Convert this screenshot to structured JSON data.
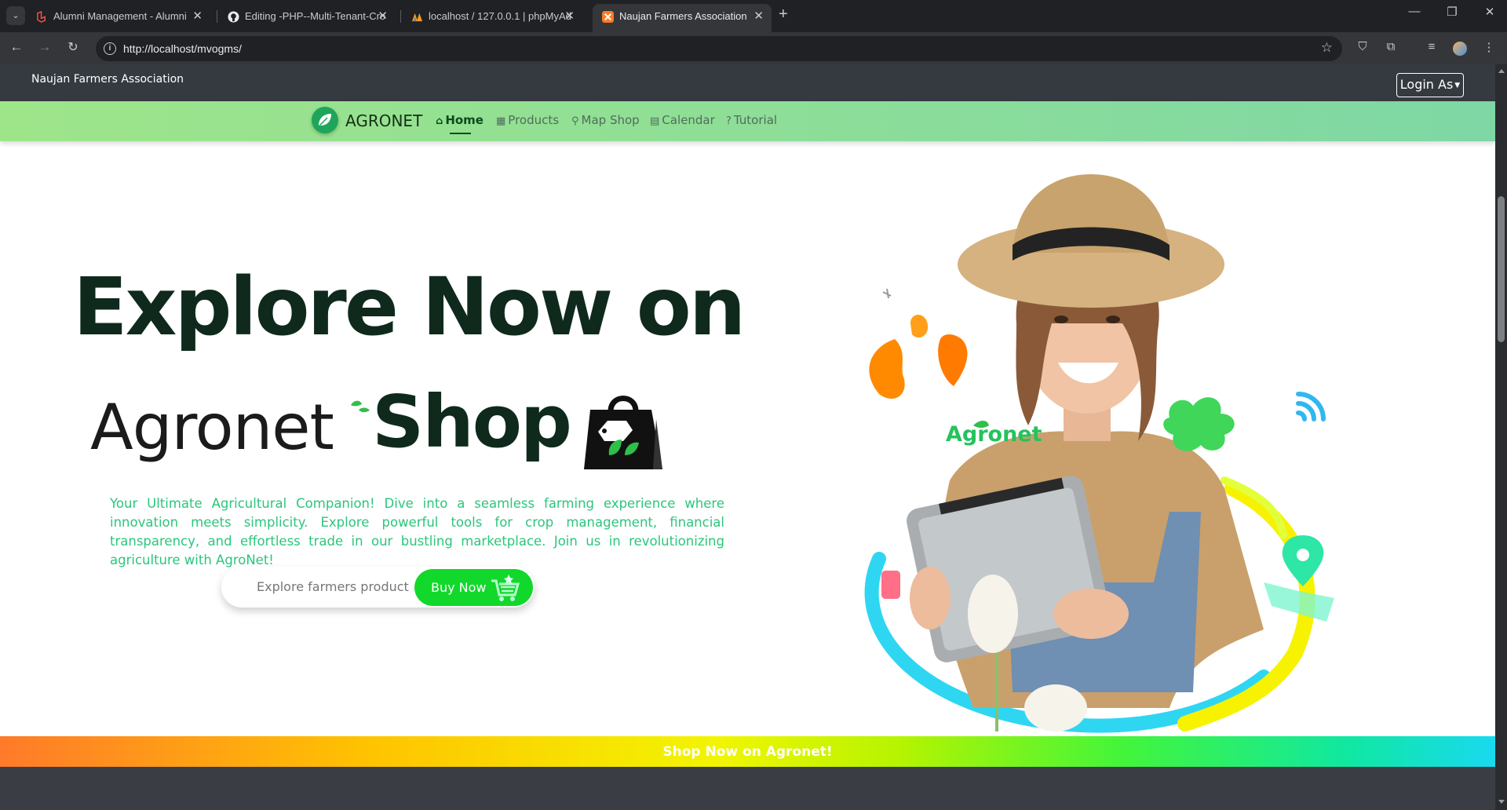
{
  "browser": {
    "tabs": [
      {
        "title": "Alumni Management - Alumni",
        "active": false
      },
      {
        "title": "Editing -PHP--Multi-Tenant-Cro",
        "active": false
      },
      {
        "title": "localhost / 127.0.0.1 | phpMyAd",
        "active": false
      },
      {
        "title": "Naujan Farmers Association",
        "active": true
      }
    ],
    "url": "http://localhost/mvogms/"
  },
  "topbar": {
    "site_name": "Naujan Farmers Association",
    "login_label": "Login As"
  },
  "navbar": {
    "brand": "AGRONET",
    "items": [
      {
        "label": "Home",
        "icon": "home-icon",
        "active": true
      },
      {
        "label": "Products",
        "icon": "box-icon",
        "active": false
      },
      {
        "label": "Map Shop",
        "icon": "map-pin-icon",
        "active": false
      },
      {
        "label": "Calendar",
        "icon": "calendar-icon",
        "active": false
      },
      {
        "label": "Tutorial",
        "icon": "question-circle-icon",
        "active": false
      }
    ]
  },
  "hero": {
    "title_line1": "Explore Now on",
    "title_agronet": "Agronet",
    "title_shop": "Shop",
    "description": "Your Ultimate Agricultural Companion! Dive into a seamless farming experience where innovation meets simplicity. Explore powerful tools for crop management, financial transparency, and effortless trade in our bustling marketplace. Join us in revolutionizing agriculture with AgroNet!",
    "cta_label": "Explore farmers product",
    "cta_button": "Buy Now",
    "illustration_brand": "Agronet"
  },
  "promo_banner": {
    "text": "Shop Now on Agronet!"
  },
  "colors": {
    "nav_gradient_start": "#9ee58a",
    "nav_gradient_end": "#7ed7a4",
    "title_color": "#0f2a1c",
    "description_color": "#2bc67b",
    "button_green": "#12d82b",
    "topbar_bg": "#353a40"
  }
}
